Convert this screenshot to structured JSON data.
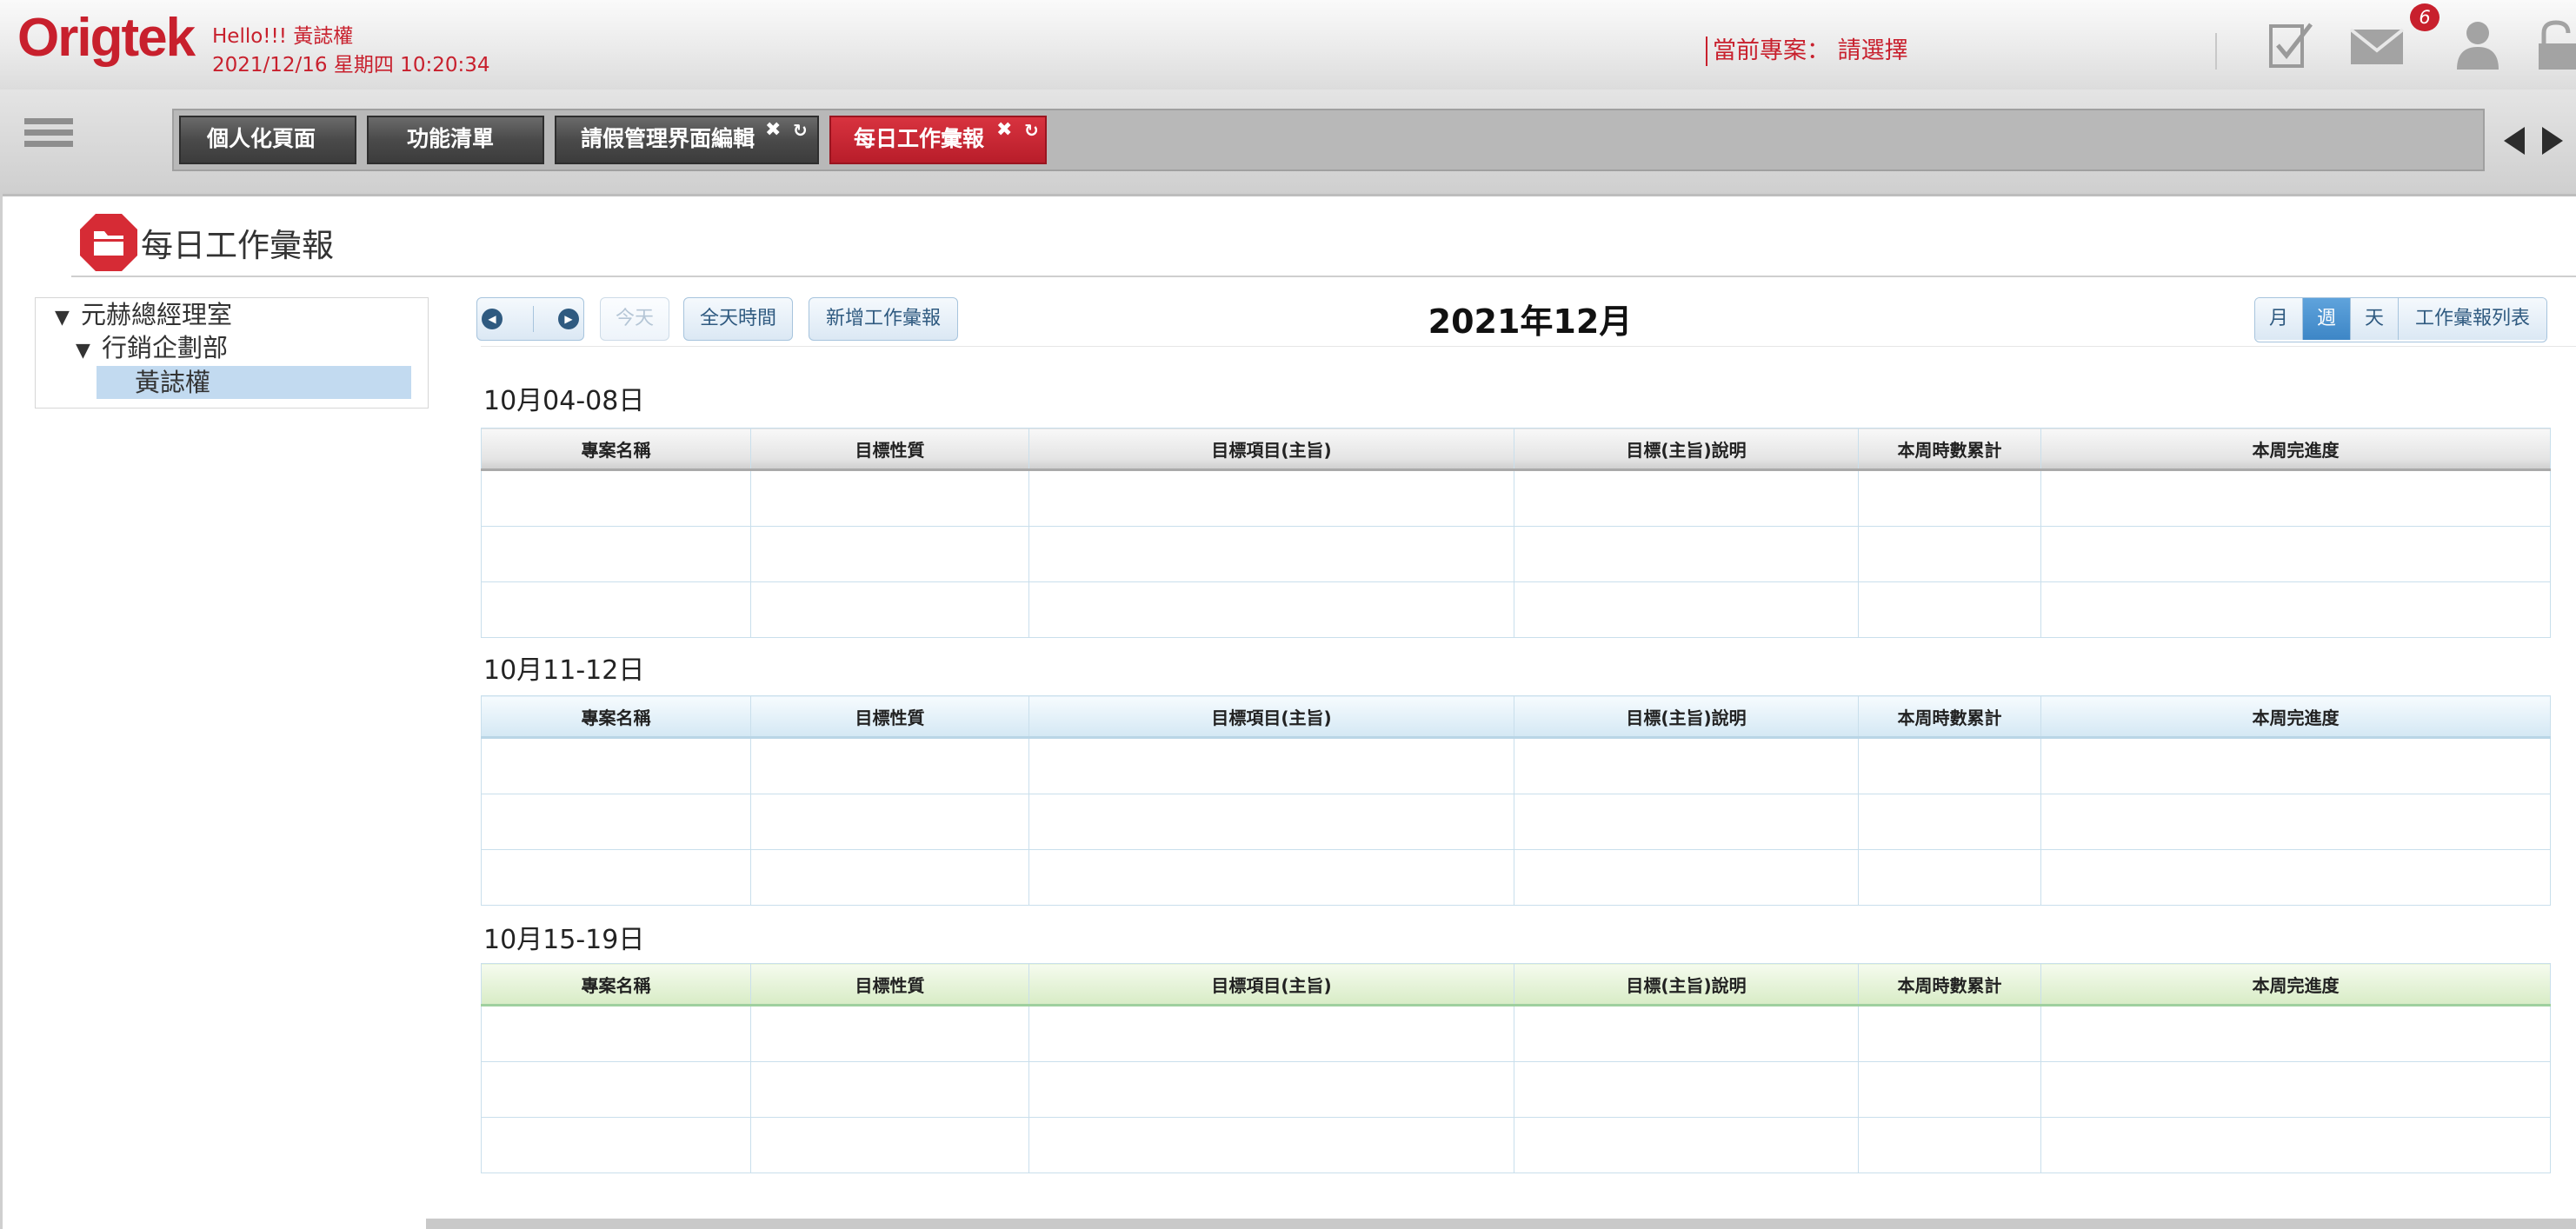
{
  "header": {
    "logo": "Origtek",
    "greeting": "Hello!!! 黃誌權",
    "datetime": "2021/12/16 星期四 10:20:34",
    "current_project": "當前專案： 請選擇",
    "mail_badge": "6",
    "brand_color": "#c8202d"
  },
  "tabs": [
    {
      "label": "個人化頁面"
    },
    {
      "label": "功能清單"
    },
    {
      "label": "請假管理界面編輯"
    },
    {
      "label": "每日工作彙報"
    }
  ],
  "tab_close_glyph": "✖",
  "tab_reload_glyph": "↻",
  "page": {
    "title": "每日工作彙報"
  },
  "tree": {
    "root": "元赫總經理室",
    "dept": "行銷企劃部",
    "person": "黃誌權"
  },
  "toolbar": {
    "prev_glyph": "◀",
    "next_glyph": "▶",
    "today": "今天",
    "all_day": "全天時間",
    "add_report": "新增工作彙報",
    "calendar_title": "2021年12月"
  },
  "views": [
    {
      "label": "月"
    },
    {
      "label": "週"
    },
    {
      "label": "天"
    },
    {
      "label": "工作彙報列表"
    }
  ],
  "active_view": "週",
  "columns": [
    "專案名稱",
    "目標性質",
    "目標項目(主旨)",
    "目標(主旨)說明",
    "本周時數累計",
    "本周完進度"
  ],
  "weeks": [
    {
      "label": "10月04-08日"
    },
    {
      "label": "10月11-12日"
    },
    {
      "label": "10月15-19日"
    }
  ]
}
